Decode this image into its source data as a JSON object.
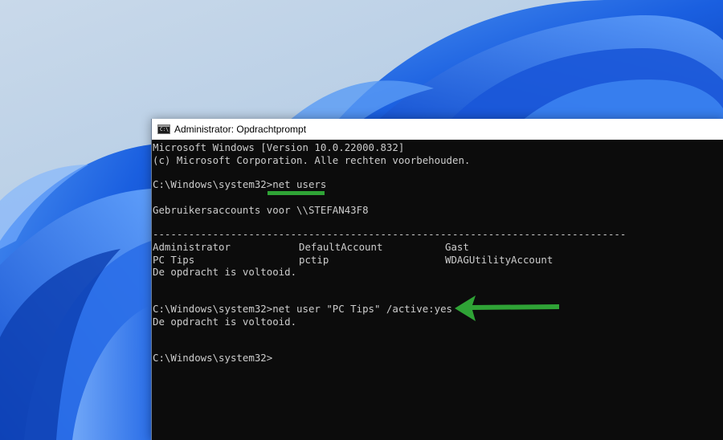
{
  "window": {
    "title": "Administrator: Opdrachtprompt",
    "icon": "cmd-icon",
    "icon_glyph": "C:\\"
  },
  "console": {
    "version_line": "Microsoft Windows [Version 10.0.22000.832]",
    "copyright_line": "(c) Microsoft Corporation. Alle rechten voorbehouden.",
    "prompt1": "C:\\Windows\\system32>net users",
    "accounts_header": "Gebruikersaccounts voor \\\\STEFAN43F8",
    "separator": "-------------------------------------------------------------------------------",
    "accounts": [
      [
        "Administrator",
        "DefaultAccount",
        "Gast"
      ],
      [
        "PC Tips",
        "pctip",
        "WDAGUtilityAccount"
      ]
    ],
    "done1": "De opdracht is voltooid.",
    "prompt2": "C:\\Windows\\system32>net user \"PC Tips\" /active:yes",
    "done2": "De opdracht is voltooid.",
    "prompt3": "C:\\Windows\\system32>"
  },
  "annotations": {
    "highlight_color": "#2fa336",
    "underline_target": "net users",
    "arrow_target": "net user \"PC Tips\" /active:yes"
  }
}
